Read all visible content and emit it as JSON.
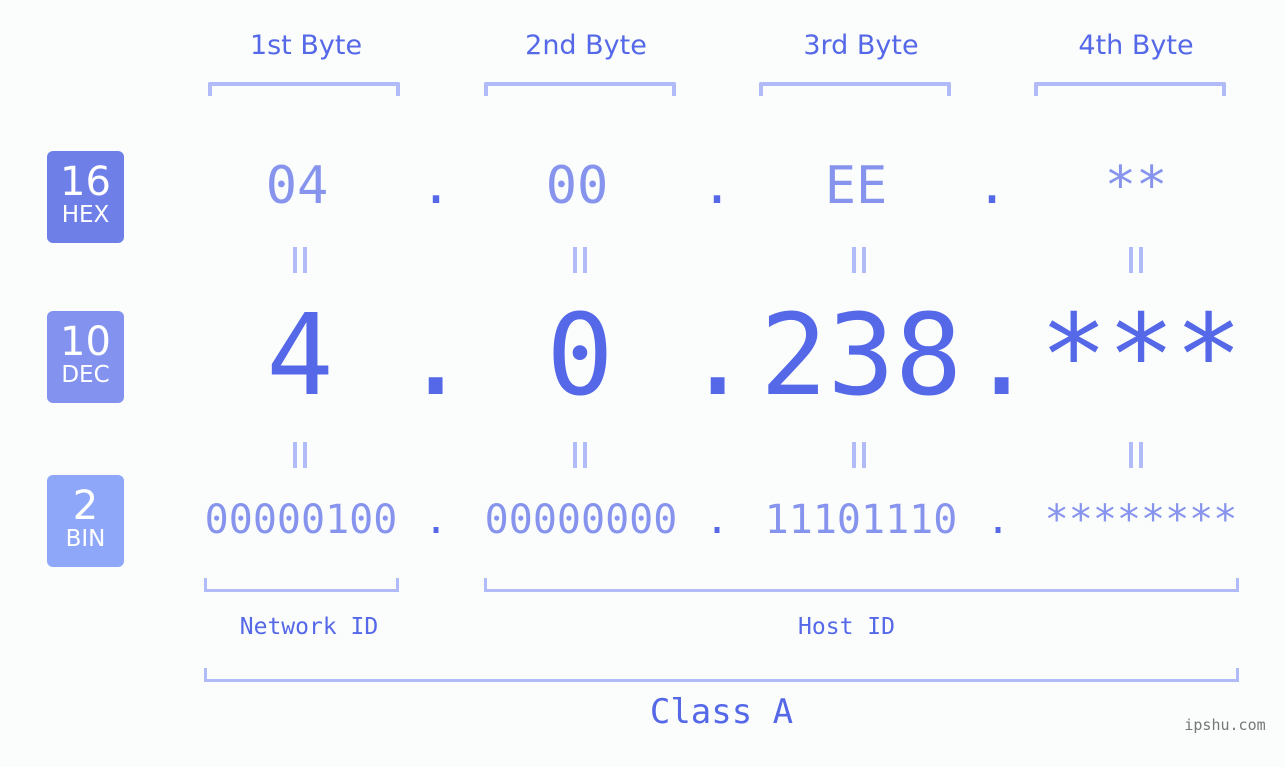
{
  "byte_headers": [
    "1st Byte",
    "2nd Byte",
    "3rd Byte",
    "4th Byte"
  ],
  "badges": {
    "hex": {
      "base": "16",
      "label": "HEX",
      "color": "#6f7fe8"
    },
    "dec": {
      "base": "10",
      "label": "DEC",
      "color": "#8292ee"
    },
    "bin": {
      "base": "2",
      "label": "BIN",
      "color": "#8fa7f8"
    }
  },
  "hex": {
    "octets": [
      "04",
      "00",
      "EE",
      "**"
    ],
    "separator": "."
  },
  "dec": {
    "octets": [
      "4",
      "0",
      "238",
      "***"
    ],
    "separator": "."
  },
  "bin": {
    "octets": [
      "00000100",
      "00000000",
      "11101110",
      "********"
    ],
    "separator": "."
  },
  "equals_symbol": "||",
  "network_id_label": "Network ID",
  "host_id_label": "Host ID",
  "class_label": "Class A",
  "watermark": "ipshu.com",
  "colors": {
    "accent": "#5468e8",
    "light_value": "#8794ee",
    "bracket": "#b0bbf7",
    "background": "#fbfdfc"
  }
}
